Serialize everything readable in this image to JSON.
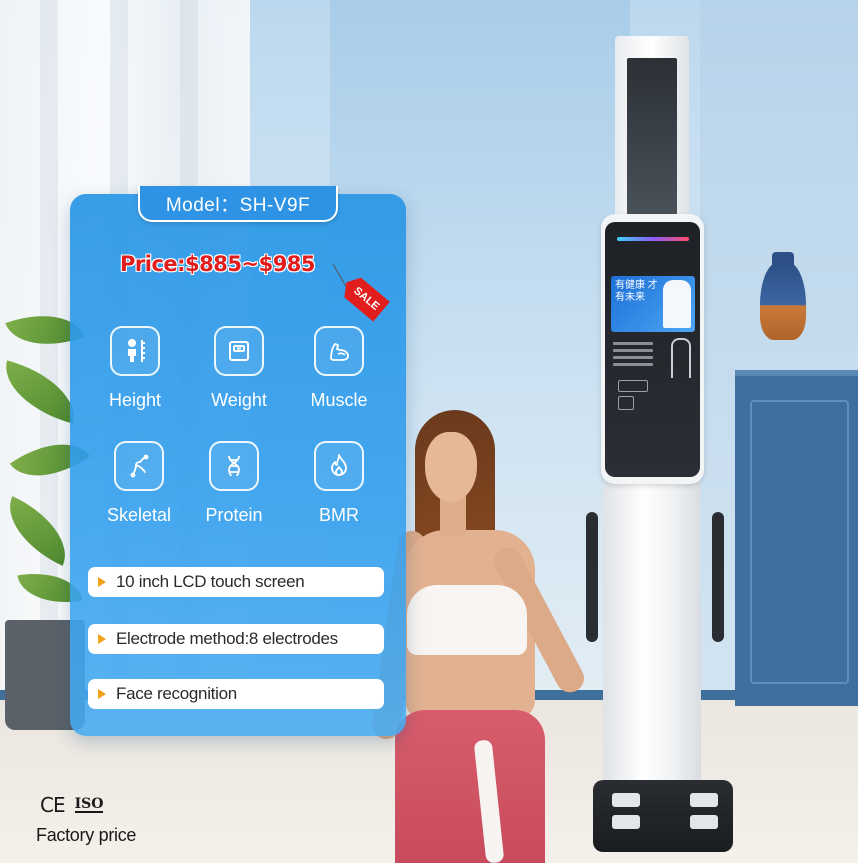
{
  "card": {
    "model_label": "Model：SH-V9F",
    "price_label": "Price:$885~$985",
    "sale_tag": "SALE"
  },
  "features": [
    {
      "label": "Height",
      "icon": "height-ruler-icon"
    },
    {
      "label": "Weight",
      "icon": "weight-scale-icon"
    },
    {
      "label": "Muscle",
      "icon": "muscle-arm-icon"
    },
    {
      "label": "Skeletal",
      "icon": "bone-icon"
    },
    {
      "label": "Protein",
      "icon": "dna-icon"
    },
    {
      "label": "BMR",
      "icon": "flame-icon"
    }
  ],
  "highlights": [
    "10 inch LCD touch screen",
    "Electrode method:8 electrodes",
    "Face recognition"
  ],
  "certs": {
    "ce": "CE",
    "iso": "ISO",
    "footer_text": "Factory price"
  },
  "device_screen": {
    "headline": "有健康 才有未来"
  },
  "colors": {
    "card_blue": "#2e93e4",
    "price_red": "#e21d1d",
    "arrow_orange": "#f0a21b"
  }
}
